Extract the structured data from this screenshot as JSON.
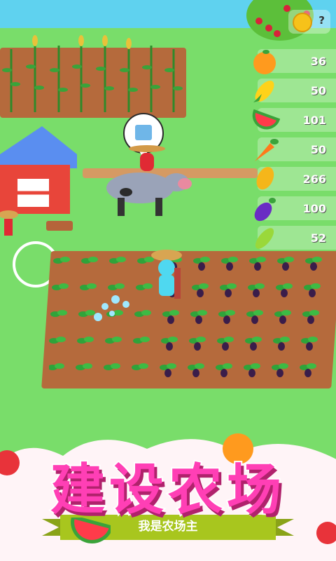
{
  "hud": {
    "coin_icon": "coin-icon",
    "help_label": "?"
  },
  "inventory": [
    {
      "icon": "orange-icon",
      "count": "36",
      "color": "#ff9a1e"
    },
    {
      "icon": "corn-icon",
      "count": "50",
      "color": "#ffd21a"
    },
    {
      "icon": "watermelon-icon",
      "count": "101",
      "color": "#ff3b4a"
    },
    {
      "icon": "carrot-icon",
      "count": "50",
      "color": "#ff7a1a"
    },
    {
      "icon": "wheat-icon",
      "count": "266",
      "color": "#f5b61a"
    },
    {
      "icon": "eggplant-icon",
      "count": "100",
      "color": "#6a2cc4"
    },
    {
      "icon": "cucumber-icon",
      "count": "52",
      "color": "#9ad83a"
    }
  ],
  "banner": {
    "title": "建设农场",
    "subtitle": "我是农场主"
  },
  "colors": {
    "title": "#ff3fb5",
    "ribbon": "#a8c61e",
    "grass": "#79dd6a",
    "soil": "#b56a3c"
  }
}
